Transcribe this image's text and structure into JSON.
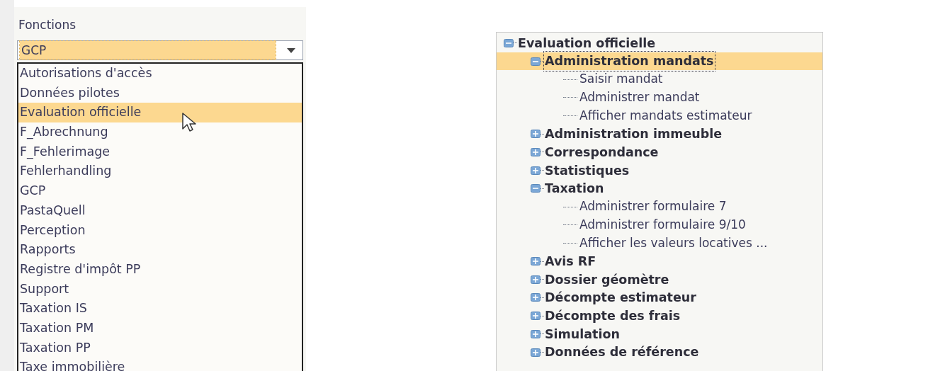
{
  "panel": {
    "label": "Fonctions",
    "combo": {
      "value": "GCP"
    },
    "options": [
      {
        "label": "Autorisations d'accès",
        "selected": false
      },
      {
        "label": "Données pilotes",
        "selected": false
      },
      {
        "label": "Evaluation officielle",
        "selected": true
      },
      {
        "label": "F_Abrechnung",
        "selected": false
      },
      {
        "label": "F_Fehlerimage",
        "selected": false
      },
      {
        "label": "Fehlerhandling",
        "selected": false
      },
      {
        "label": "GCP",
        "selected": false
      },
      {
        "label": "PastaQuell",
        "selected": false
      },
      {
        "label": "Perception",
        "selected": false
      },
      {
        "label": "Rapports",
        "selected": false
      },
      {
        "label": "Registre d'impôt PP",
        "selected": false
      },
      {
        "label": "Support",
        "selected": false
      },
      {
        "label": "Taxation IS",
        "selected": false
      },
      {
        "label": "Taxation PM",
        "selected": false
      },
      {
        "label": "Taxation PP",
        "selected": false
      },
      {
        "label": "Taxe immobilière",
        "selected": false
      }
    ]
  },
  "tree": {
    "label": "Evaluation officielle",
    "kind": "branch",
    "expanded": true,
    "selected": false,
    "children": [
      {
        "label": "Administration mandats",
        "kind": "branch",
        "expanded": true,
        "selected": true,
        "children": [
          {
            "label": "Saisir mandat",
            "kind": "leaf",
            "selected": false
          },
          {
            "label": "Administrer mandat",
            "kind": "leaf",
            "selected": false
          },
          {
            "label": "Afficher mandats estimateur",
            "kind": "leaf",
            "selected": false
          }
        ]
      },
      {
        "label": "Administration immeuble",
        "kind": "branch",
        "expanded": false,
        "selected": false
      },
      {
        "label": "Correspondance",
        "kind": "branch",
        "expanded": false,
        "selected": false
      },
      {
        "label": "Statistiques",
        "kind": "branch",
        "expanded": false,
        "selected": false
      },
      {
        "label": "Taxation",
        "kind": "branch",
        "expanded": true,
        "selected": false,
        "children": [
          {
            "label": "Administrer formulaire 7",
            "kind": "leaf",
            "selected": false
          },
          {
            "label": "Administrer formulaire 9/10",
            "kind": "leaf",
            "selected": false
          },
          {
            "label": "Afficher les valeurs locatives ...",
            "kind": "leaf",
            "selected": false
          }
        ]
      },
      {
        "label": "Avis RF",
        "kind": "branch",
        "expanded": false,
        "selected": false
      },
      {
        "label": "Dossier géomètre",
        "kind": "branch",
        "expanded": false,
        "selected": false
      },
      {
        "label": "Décompte estimateur",
        "kind": "branch",
        "expanded": false,
        "selected": false
      },
      {
        "label": "Décompte des frais",
        "kind": "branch",
        "expanded": false,
        "selected": false
      },
      {
        "label": "Simulation",
        "kind": "branch",
        "expanded": false,
        "selected": false
      },
      {
        "label": "Données de référence",
        "kind": "branch",
        "expanded": false,
        "selected": false
      }
    ]
  }
}
